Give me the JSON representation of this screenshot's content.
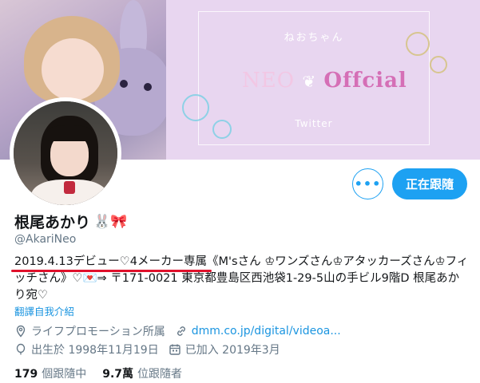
{
  "banner": {
    "subtitle": "ねおちゃん",
    "title_part1": "NEO",
    "title_part2": "Offcial",
    "caption": "Twitter"
  },
  "profile": {
    "name": "根尾あかり",
    "name_emojis": "🐰🎀",
    "handle": "@AkariNeo",
    "bio_underlined": "2019.4.13デビュー♡4メーカー専属",
    "bio_rest": "《M'sさん ♔ワンズさん♔アタッカーズさん♔フィッチさん》♡💌⇒ 〒171-0021 東京都豊島区西池袋1-29-5山の手ビル9階D 根尾あかり宛♡",
    "translate": "翻譯自我介紹",
    "location": "ライフプロモーション所属",
    "website": "dmm.co.jp/digital/videoa...",
    "birthday": "出生於 1998年11月19日",
    "joined": "已加入 2019年3月"
  },
  "buttons": {
    "more": "•••",
    "following": "正在跟隨"
  },
  "stats": {
    "following_count": "179",
    "following_label": "個跟隨中",
    "followers_count": "9.7萬",
    "followers_label": "位跟隨者"
  },
  "colors": {
    "accent": "#1da1f2",
    "link": "#1b95e0",
    "muted": "#657786",
    "underline": "#e0102b",
    "banner": "#e8d6f0"
  }
}
